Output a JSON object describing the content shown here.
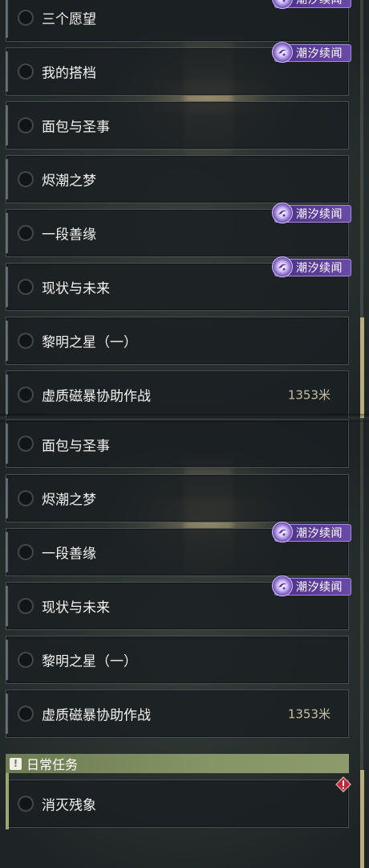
{
  "badge_text": "潮汐续闻",
  "top_panel": {
    "items": [
      {
        "label": "三个愿望"
      },
      {
        "label": "我的搭档"
      },
      {
        "label": "面包与圣事"
      },
      {
        "label": "烬潮之梦"
      },
      {
        "label": "一段善缘"
      },
      {
        "label": "现状与未来"
      },
      {
        "label": "黎明之星（一）"
      },
      {
        "label": "虚质磁暴协助作战",
        "distance": "1353米"
      }
    ]
  },
  "bottom_panel": {
    "items": [
      {
        "label": "面包与圣事"
      },
      {
        "label": "烬潮之梦"
      },
      {
        "label": "一段善缘"
      },
      {
        "label": "现状与未来"
      },
      {
        "label": "黎明之星（一）"
      },
      {
        "label": "虚质磁暴协助作战",
        "distance": "1353米"
      }
    ],
    "section": {
      "title": "日常任务",
      "icon": "exclamation-icon"
    },
    "daily_items": [
      {
        "label": "消灭残象"
      }
    ]
  },
  "colors": {
    "badge": "#5b3d9a",
    "section": "#849566",
    "scroll_thumb": "#b9ad7a",
    "alert": "#c0283a"
  }
}
